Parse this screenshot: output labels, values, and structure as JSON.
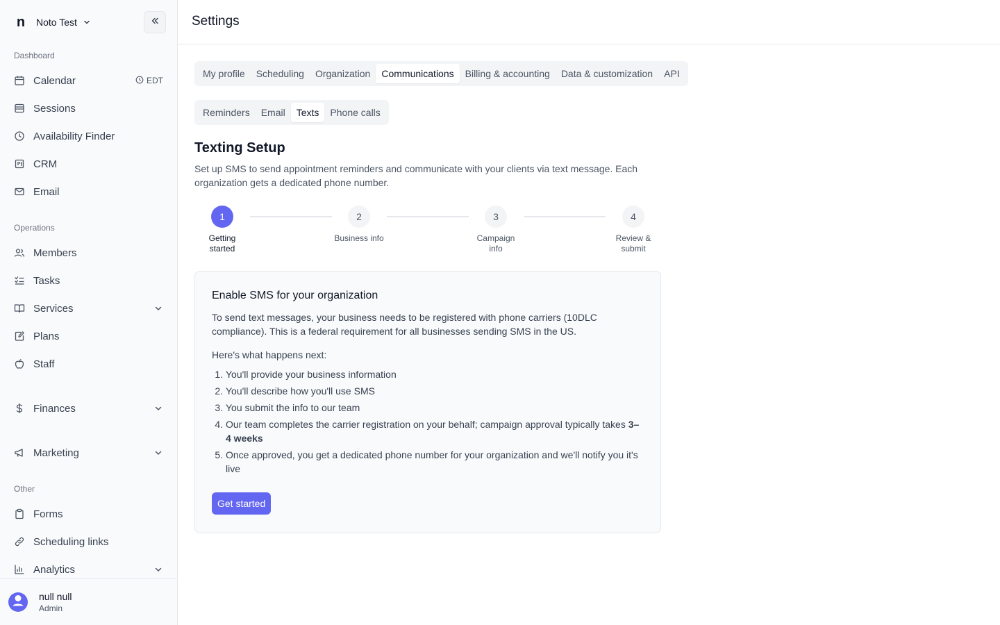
{
  "org": {
    "logo": "n",
    "name": "Noto Test"
  },
  "sidebar": {
    "sections": [
      {
        "label": "Dashboard"
      },
      {
        "label": "Operations"
      },
      {
        "label": "Other"
      }
    ],
    "items": [
      {
        "label": "Calendar",
        "icon": "calendar-icon",
        "badge": "EDT"
      },
      {
        "label": "Sessions",
        "icon": "list-icon"
      },
      {
        "label": "Availability Finder",
        "icon": "clock-icon"
      },
      {
        "label": "CRM",
        "icon": "kanban-icon"
      },
      {
        "label": "Email",
        "icon": "mail-icon"
      },
      {
        "label": "Members",
        "icon": "users-icon"
      },
      {
        "label": "Tasks",
        "icon": "checklist-icon"
      },
      {
        "label": "Services",
        "icon": "book-icon",
        "expandable": true
      },
      {
        "label": "Plans",
        "icon": "notebook-icon"
      },
      {
        "label": "Staff",
        "icon": "apple-icon"
      },
      {
        "label": "Finances",
        "icon": "dollar-icon",
        "expandable": true
      },
      {
        "label": "Marketing",
        "icon": "megaphone-icon",
        "expandable": true
      },
      {
        "label": "Forms",
        "icon": "clipboard-icon"
      },
      {
        "label": "Scheduling links",
        "icon": "link-icon"
      },
      {
        "label": "Analytics",
        "icon": "bar-chart-icon",
        "expandable": true
      }
    ]
  },
  "user": {
    "name": "null null",
    "role": "Admin"
  },
  "header": {
    "title": "Settings"
  },
  "main_tabs": [
    {
      "label": "My profile"
    },
    {
      "label": "Scheduling"
    },
    {
      "label": "Organization"
    },
    {
      "label": "Communications",
      "active": true
    },
    {
      "label": "Billing & accounting"
    },
    {
      "label": "Data & customization"
    },
    {
      "label": "API"
    }
  ],
  "sub_tabs": [
    {
      "label": "Reminders"
    },
    {
      "label": "Email"
    },
    {
      "label": "Texts",
      "active": true
    },
    {
      "label": "Phone calls"
    }
  ],
  "section": {
    "title": "Texting Setup",
    "description": "Set up SMS to send appointment reminders and communicate with your clients via text message. Each organization gets a dedicated phone number."
  },
  "steps": [
    {
      "number": "1",
      "label": "Getting started",
      "active": true
    },
    {
      "number": "2",
      "label": "Business info"
    },
    {
      "number": "3",
      "label": "Campaign info"
    },
    {
      "number": "4",
      "label": "Review & submit"
    }
  ],
  "card": {
    "title": "Enable SMS for your organization",
    "text": "To send text messages, your business needs to be registered with phone carriers (10DLC compliance). This is a federal requirement for all businesses sending SMS in the US.",
    "subtitle": "Here's what happens next:",
    "list": [
      "You'll provide your business information",
      "You'll describe how you'll use SMS",
      "You submit the info to our team",
      "Our team completes the carrier registration on your behalf; campaign approval typically takes ",
      "Once approved, you get a dedicated phone number for your organization and we'll notify you it's live"
    ],
    "list_bold": "3–4 weeks",
    "button": "Get started"
  },
  "colors": {
    "accent": "#6366f1",
    "border": "#e5e7eb",
    "muted": "#6b7280"
  }
}
